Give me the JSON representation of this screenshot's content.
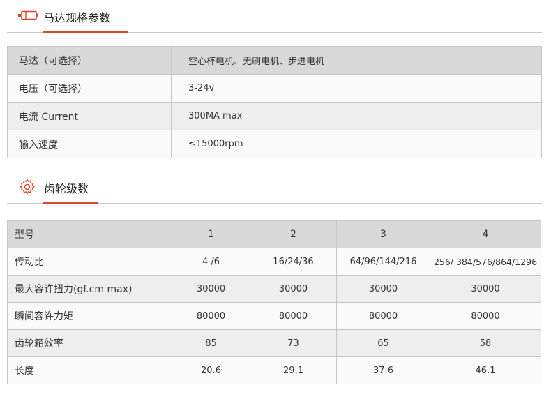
{
  "section1": {
    "title": "马达规格参数",
    "icon": "motor-icon"
  },
  "spec_rows": [
    {
      "label": "马达（可选择）",
      "value": "空心杯电机、无刷电机、步进电机"
    },
    {
      "label": "电压（可选择）",
      "value": "3-24v"
    },
    {
      "label": "电流  Current",
      "value": "300MA max"
    },
    {
      "label": "输入速度",
      "value": "≤15000rpm"
    }
  ],
  "section2": {
    "title": "齿轮级数",
    "icon": "gear-icon"
  },
  "gear_table": {
    "header": {
      "label": "型号",
      "cols": [
        "1",
        "2",
        "3",
        "4"
      ]
    },
    "rows": [
      {
        "label": "传动比",
        "values": [
          "4 /6",
          "16/24/36",
          "64/96/144/216",
          "256/ 384/576/864/1296"
        ]
      },
      {
        "label": "最大容许扭力(gf.cm  max)",
        "values": [
          "30000",
          "30000",
          "30000",
          "30000"
        ]
      },
      {
        "label": "瞬间容许力矩",
        "values": [
          "80000",
          "80000",
          "80000",
          "80000"
        ]
      },
      {
        "label": "齿轮箱效率",
        "values": [
          "85",
          "73",
          "65",
          "58"
        ]
      },
      {
        "label": "长度",
        "values": [
          "20.6",
          "29.1",
          "37.6",
          "46.1"
        ]
      }
    ]
  },
  "colors": {
    "accent": "#e0442e",
    "header_row": "#d9d9d9",
    "row_alt": "#eeeeee",
    "border": "#c6c6c6"
  }
}
